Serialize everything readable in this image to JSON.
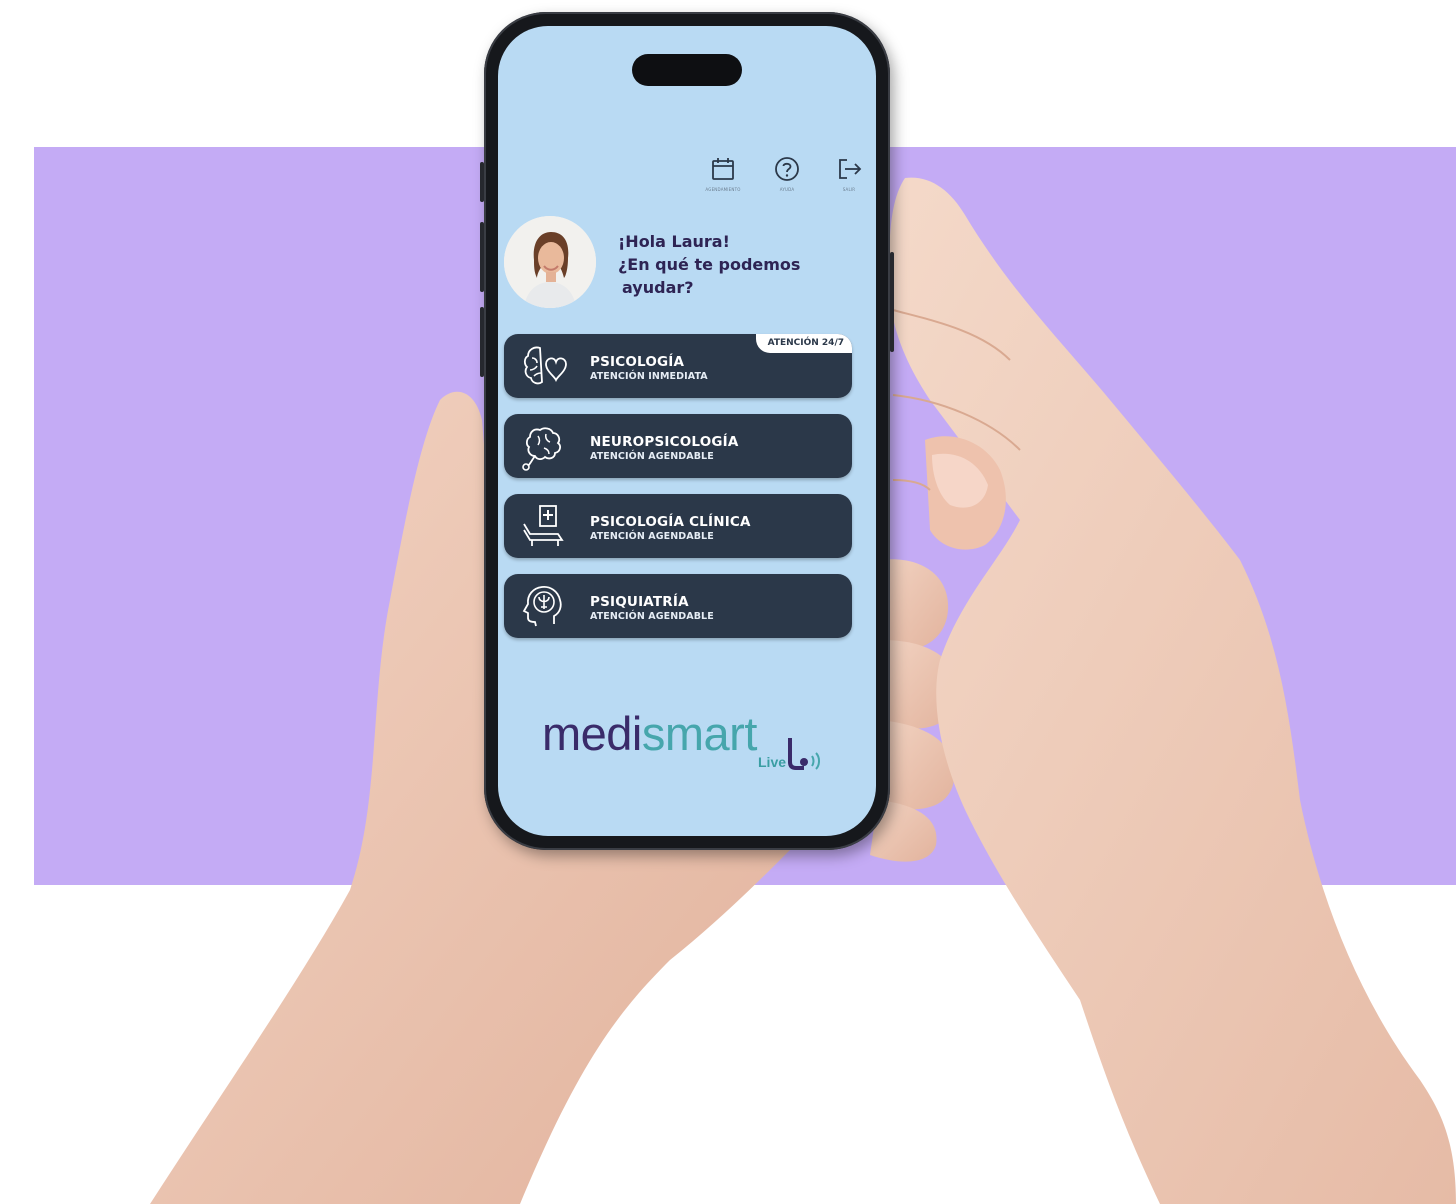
{
  "header": {
    "actions": [
      {
        "name": "calendar",
        "label": "Agendamiento"
      },
      {
        "name": "help",
        "label": "Ayuda"
      },
      {
        "name": "logout",
        "label": "Salir"
      }
    ]
  },
  "greeting": {
    "line1": "¡Hola Laura!",
    "line2": "¿En qué te podemos",
    "line3": "ayudar?"
  },
  "services": [
    {
      "title": "PSICOLOGÍA",
      "subtitle": "ATENCIÓN INMEDIATA",
      "badge": "ATENCIÓN 24/7",
      "icon": "brain-heart-icon"
    },
    {
      "title": "NEUROPSICOLOGÍA",
      "subtitle": "ATENCIÓN AGENDABLE",
      "icon": "brain-stethoscope-icon"
    },
    {
      "title": "PSICOLOGÍA CLÍNICA",
      "subtitle": "ATENCIÓN AGENDABLE",
      "icon": "therapy-couch-icon"
    },
    {
      "title": "PSIQUIATRÍA",
      "subtitle": "ATENCIÓN AGENDABLE",
      "icon": "head-psi-icon"
    }
  ],
  "logo": {
    "medi": "medi",
    "smart": "smart",
    "live": "Live"
  },
  "colors": {
    "background_band": "#c4abf5",
    "screen": "#b9daf3",
    "card": "#2b3849",
    "greeting_text": "#2e2454",
    "logo_primary": "#3a2b6a",
    "logo_accent": "#46a6ac"
  }
}
